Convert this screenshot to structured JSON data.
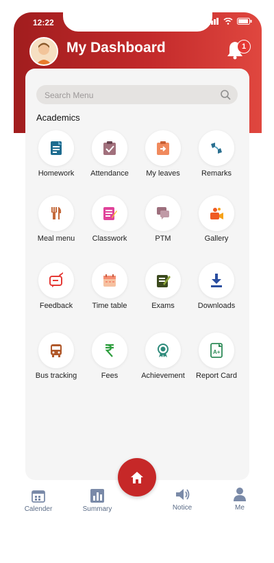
{
  "status_bar": {
    "time": "12:22"
  },
  "header": {
    "title": "My Dashboard",
    "notification_count": "1"
  },
  "search": {
    "placeholder": "Search Menu"
  },
  "section_title": "Academics",
  "menu": [
    {
      "label": "Homework",
      "icon": "homework-icon"
    },
    {
      "label": "Attendance",
      "icon": "attendance-icon"
    },
    {
      "label": "My leaves",
      "icon": "leaves-icon"
    },
    {
      "label": "Remarks",
      "icon": "remarks-icon"
    },
    {
      "label": "Meal menu",
      "icon": "meal-icon"
    },
    {
      "label": "Classwork",
      "icon": "classwork-icon"
    },
    {
      "label": "PTM",
      "icon": "ptm-icon"
    },
    {
      "label": "Gallery",
      "icon": "gallery-icon"
    },
    {
      "label": "Feedback",
      "icon": "feedback-icon"
    },
    {
      "label": "Time table",
      "icon": "timetable-icon"
    },
    {
      "label": "Exams",
      "icon": "exams-icon"
    },
    {
      "label": "Downloads",
      "icon": "downloads-icon"
    },
    {
      "label": "Bus tracking",
      "icon": "bus-icon"
    },
    {
      "label": "Fees",
      "icon": "rupee-icon"
    },
    {
      "label": "Achievement",
      "icon": "achievement-icon"
    },
    {
      "label": "Report Card",
      "icon": "report-card-icon"
    }
  ],
  "bottom_nav": {
    "calender": "Calender",
    "summary": "Summary",
    "notice": "Notice",
    "me": "Me"
  }
}
